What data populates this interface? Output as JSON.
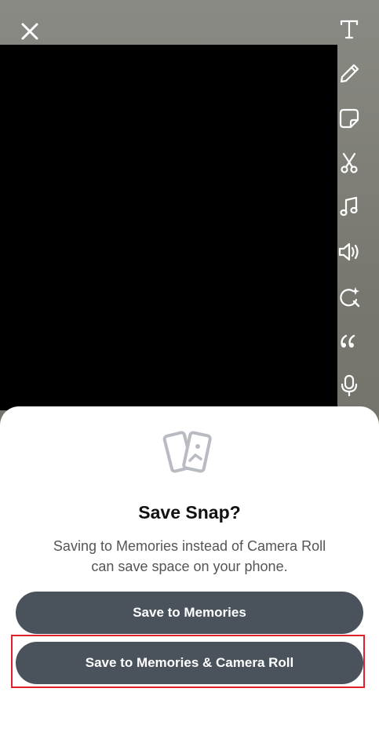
{
  "editor": {
    "close_icon": "close-icon",
    "tools": [
      {
        "name": "text-tool",
        "icon": "text-icon"
      },
      {
        "name": "pencil-tool",
        "icon": "pencil-icon"
      },
      {
        "name": "sticker-tool",
        "icon": "sticker-icon"
      },
      {
        "name": "scissors-tool",
        "icon": "scissors-icon"
      },
      {
        "name": "music-tool",
        "icon": "music-note-icon"
      },
      {
        "name": "volume-tool",
        "icon": "speaker-icon"
      },
      {
        "name": "lens-tool",
        "icon": "magic-lens-icon"
      },
      {
        "name": "caption-tool",
        "icon": "quote-icon"
      },
      {
        "name": "voice-tool",
        "icon": "microphone-icon"
      }
    ]
  },
  "dialog": {
    "icon": "photos-icon",
    "title": "Save Snap?",
    "description": "Saving to Memories instead of Camera Roll can save space on your phone.",
    "primary_button": "Save to Memories",
    "secondary_button": "Save to Memories & Camera Roll"
  },
  "colors": {
    "button_bg": "#4a535c",
    "highlight": "#e0202a"
  }
}
